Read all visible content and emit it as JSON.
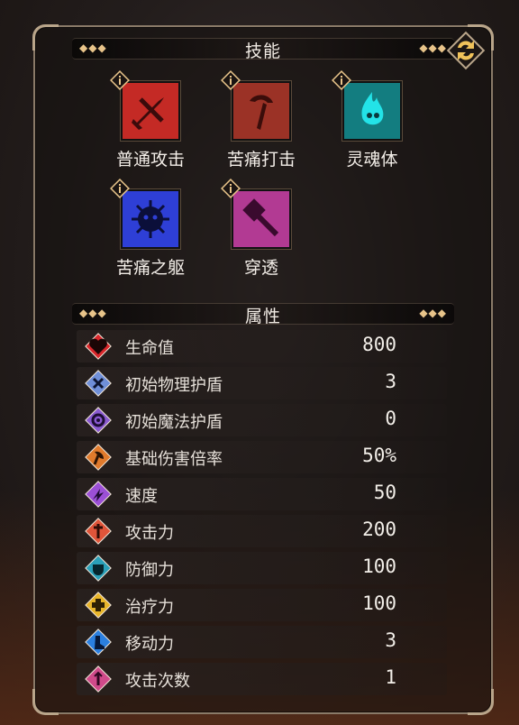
{
  "skills_section": {
    "title": "技能"
  },
  "skills": [
    {
      "name": "普通攻击",
      "icon": "sword-icon",
      "bg": "#c42a25"
    },
    {
      "name": "苦痛打击",
      "icon": "scythe-icon",
      "bg": "#9b3226"
    },
    {
      "name": "灵魂体",
      "icon": "soul-flame-icon",
      "bg": "#137d80"
    },
    {
      "name": "苦痛之躯",
      "icon": "spiked-body-icon",
      "bg": "#2e3fd6"
    },
    {
      "name": "穿透",
      "icon": "hammer-icon",
      "bg": "#b23a93"
    }
  ],
  "attributes_section": {
    "title": "属性"
  },
  "attributes": [
    {
      "label": "生命值",
      "value": "800",
      "icon": "heart-icon",
      "color": "#d9262b"
    },
    {
      "label": "初始物理护盾",
      "value": "3",
      "icon": "physical-shield-icon",
      "color": "#6f8fd8"
    },
    {
      "label": "初始魔法护盾",
      "value": "0",
      "icon": "magic-shield-icon",
      "color": "#8a5ad0"
    },
    {
      "label": "基础伤害倍率",
      "value": "50%",
      "icon": "axe-icon",
      "color": "#e07a2c"
    },
    {
      "label": "速度",
      "value": "50",
      "icon": "speed-icon",
      "color": "#9b4fd6"
    },
    {
      "label": "攻击力",
      "value": "200",
      "icon": "attack-sword-icon",
      "color": "#e0553a"
    },
    {
      "label": "防御力",
      "value": "100",
      "icon": "defense-armor-icon",
      "color": "#2aa0b8"
    },
    {
      "label": "治疗力",
      "value": "100",
      "icon": "heal-cross-icon",
      "color": "#e8b52a"
    },
    {
      "label": "移动力",
      "value": "3",
      "icon": "boot-icon",
      "color": "#2a7fe0"
    },
    {
      "label": "攻击次数",
      "value": "1",
      "icon": "attack-count-icon",
      "color": "#d04a8a"
    }
  ],
  "colors": {
    "accent_gold": "#e8c48a",
    "frame": "#8a7a68"
  }
}
